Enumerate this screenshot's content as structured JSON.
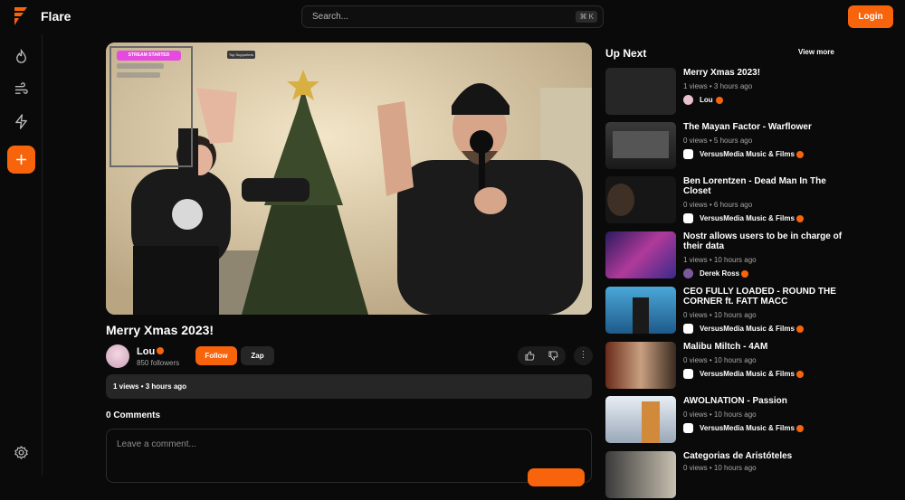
{
  "header": {
    "brand": "Flare",
    "search_placeholder": "Search...",
    "search_shortcut": "⌘ K",
    "login_label": "Login"
  },
  "sidebar": {
    "icons": [
      "flame-icon",
      "wind-icon",
      "lightning-icon",
      "plus-icon",
      "settings-icon"
    ]
  },
  "video": {
    "overlay_badge": "STREAM STARTED",
    "overlay_top_supporters": "Top Supporters",
    "title": "Merry Xmas 2023!",
    "author": "Lou",
    "followers": "850 followers",
    "follow_label": "Follow",
    "zap_label": "Zap",
    "more_label": "⋮",
    "stats": "1 views  •  3 hours ago"
  },
  "comments": {
    "title": "0 Comments",
    "placeholder": "Leave a comment..."
  },
  "up_next": {
    "heading": "Up Next",
    "view_more": "View more",
    "items": [
      {
        "title": "Merry Xmas 2023!",
        "meta": "1 views  •  3 hours ago",
        "channel": "Lou"
      },
      {
        "title": "The Mayan Factor - Warflower",
        "meta": "0 views  •  5 hours ago",
        "channel": "VersusMedia Music & Films"
      },
      {
        "title": "Ben Lorentzen - Dead Man In The Closet",
        "meta": "0 views  •  6 hours ago",
        "channel": "VersusMedia Music & Films"
      },
      {
        "title": "Nostr allows users to be in charge of their data",
        "meta": "1 views  •  10 hours ago",
        "channel": "Derek Ross"
      },
      {
        "title": "CEO FULLY LOADED - ROUND THE CORNER ft. FATT MACC",
        "meta": "0 views  •  10 hours ago",
        "channel": "VersusMedia Music & Films"
      },
      {
        "title": "Malibu Miltch - 4AM",
        "meta": "0 views  •  10 hours ago",
        "channel": "VersusMedia Music & Films"
      },
      {
        "title": "AWOLNATION - Passion",
        "meta": "0 views  •  10 hours ago",
        "channel": "VersusMedia Music & Films"
      },
      {
        "title": "Categorias de Aristóteles",
        "meta": "0 views  •  10 hours ago",
        "channel": ""
      }
    ]
  },
  "colors": {
    "accent": "#f7640c",
    "background": "#0a0a0a",
    "surface": "#262626"
  }
}
